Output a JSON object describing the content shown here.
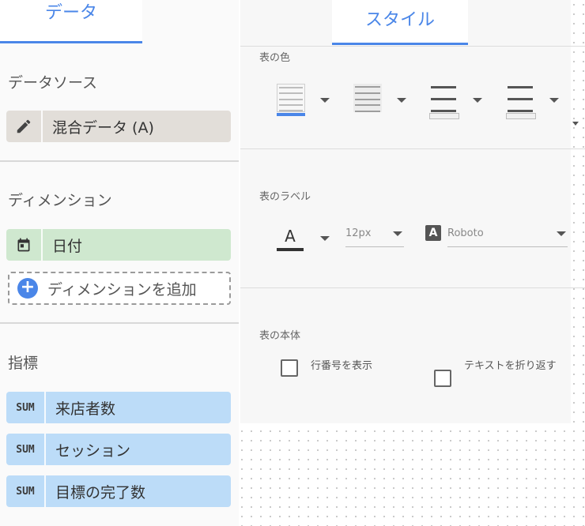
{
  "tabs": {
    "data": "データ",
    "style": "スタイル"
  },
  "data_panel": {
    "data_source_title": "データソース",
    "data_source_label": "混合データ (A)",
    "dimension_title": "ディメンション",
    "dimension_label": "日付",
    "add_dimension_label": "ディメンションを追加",
    "metric_title": "指標",
    "metrics": [
      {
        "agg": "SUM",
        "label": "来店者数"
      },
      {
        "agg": "SUM",
        "label": "セッション"
      },
      {
        "agg": "SUM",
        "label": "目標の完了数"
      }
    ]
  },
  "style_panel": {
    "table_colors_title": "表の色",
    "table_labels_title": "表のラベル",
    "font_size": "12px",
    "font_family": "Roboto",
    "table_body_title": "表の本体",
    "show_row_numbers_label": "行番号を表示",
    "wrap_text_label": "テキストを折り返す",
    "colors": {
      "accent": "#4a86e8",
      "font_color_bar": "#333333"
    }
  }
}
